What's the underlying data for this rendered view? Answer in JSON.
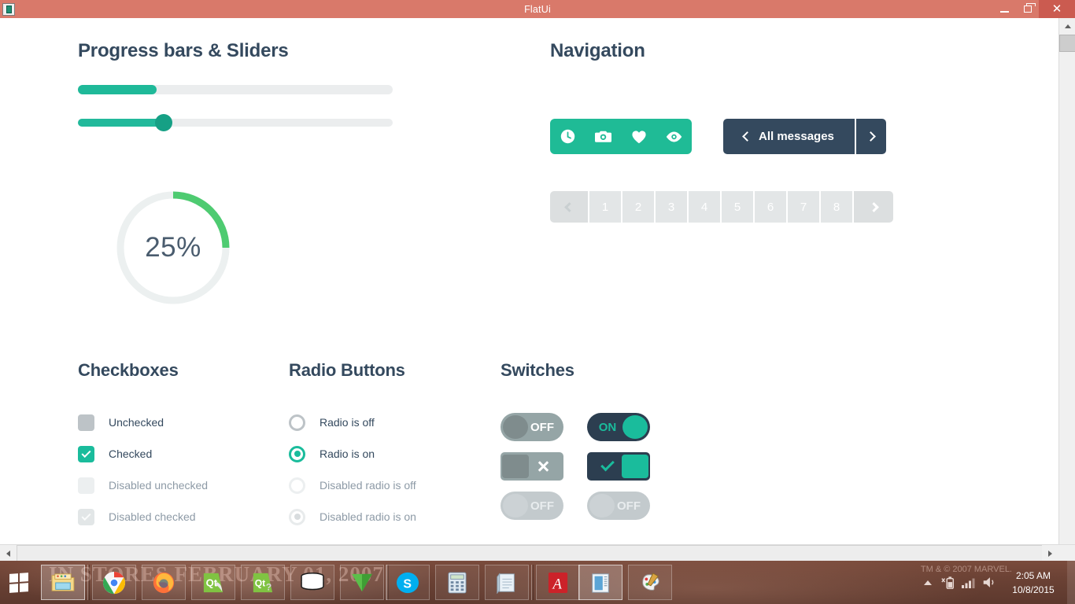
{
  "window": {
    "title": "FlatUi",
    "app_icon": "qt-app-icon",
    "controls": {
      "minimize": "minimize",
      "maximize": "restore",
      "close": "close"
    }
  },
  "sections": {
    "progress": {
      "heading": "Progress bars & Sliders",
      "progress_bar": {
        "value": 25,
        "max": 100
      },
      "slider": {
        "value": 27,
        "max": 100
      },
      "circle": {
        "value": 25,
        "label": "25%"
      }
    },
    "navigation": {
      "heading": "Navigation",
      "icon_buttons": [
        {
          "name": "clock-icon",
          "glyph": "clock"
        },
        {
          "name": "camera-icon",
          "glyph": "camera"
        },
        {
          "name": "heart-icon",
          "glyph": "heart"
        },
        {
          "name": "eye-icon",
          "glyph": "eye"
        }
      ],
      "messages_button": {
        "label": "All  messages",
        "prev": "‹",
        "next": "›"
      },
      "pagination": {
        "prev": "prev",
        "pages": [
          "1",
          "2",
          "3",
          "4",
          "5",
          "6",
          "7",
          "8"
        ],
        "next": "next"
      }
    },
    "checkboxes": {
      "heading": "Checkboxes",
      "items": [
        {
          "label": "Unchecked",
          "state": "unchecked",
          "disabled": false
        },
        {
          "label": "Checked",
          "state": "checked",
          "disabled": false
        },
        {
          "label": "Disabled unchecked",
          "state": "unchecked",
          "disabled": true
        },
        {
          "label": "Disabled checked",
          "state": "checked",
          "disabled": true
        }
      ]
    },
    "radios": {
      "heading": "Radio Buttons",
      "items": [
        {
          "label": "Radio is off",
          "state": "off",
          "disabled": false
        },
        {
          "label": "Radio is on",
          "state": "on",
          "disabled": false
        },
        {
          "label": "Disabled radio is off",
          "state": "off",
          "disabled": true
        },
        {
          "label": "Disabled radio is on",
          "state": "on",
          "disabled": true
        }
      ]
    },
    "switches": {
      "heading": "Switches",
      "items": [
        {
          "name": "switch-off",
          "label": "OFF",
          "state": "off",
          "shape": "round",
          "disabled": false
        },
        {
          "name": "switch-on",
          "label": "ON",
          "state": "on",
          "shape": "round",
          "disabled": false
        },
        {
          "name": "switch-square-off",
          "label": "",
          "state": "off",
          "shape": "square",
          "icon": "x-icon",
          "disabled": false
        },
        {
          "name": "switch-square-on",
          "label": "",
          "state": "on",
          "shape": "square",
          "icon": "check-icon",
          "disabled": false
        },
        {
          "name": "switch-disabled-off-a",
          "label": "OFF",
          "state": "off",
          "shape": "round",
          "disabled": true
        },
        {
          "name": "switch-disabled-off-b",
          "label": "OFF",
          "state": "off",
          "shape": "round",
          "disabled": true
        }
      ]
    }
  },
  "colors": {
    "titlebar": "#d9796a",
    "close_button": "#cb5b50",
    "accent_green": "#1abc9c",
    "progress_green": "#1fb999",
    "circle_green": "#4ecb71",
    "dark_navy": "#34495e",
    "heading_text": "#34495e",
    "track_gray": "#ebedee",
    "pagination_gray": "#e3e6e7",
    "switch_gray": "#95a5a6",
    "taskbar": "#6f4436"
  },
  "taskbar": {
    "start": "start-button",
    "background_text": "IN STORES FEBRUARY 01, 2007",
    "trademark_text": "TM & © 2007 MARVEL.",
    "items": [
      {
        "name": "taskbar-file-explorer",
        "icon": "folder-icon",
        "active": true
      },
      {
        "name": "taskbar-google-chrome",
        "icon": "chrome-icon",
        "active": false
      },
      {
        "name": "taskbar-firefox",
        "icon": "firefox-icon",
        "active": false
      },
      {
        "name": "taskbar-qt-creator",
        "icon": "qt-creator-icon",
        "active": false
      },
      {
        "name": "taskbar-qt-assistant",
        "icon": "qt-assistant-icon",
        "active": false
      },
      {
        "name": "taskbar-database",
        "icon": "database-icon",
        "active": false
      },
      {
        "name": "taskbar-green-triangle",
        "icon": "triangle-icon",
        "active": false
      },
      {
        "name": "taskbar-skype",
        "icon": "skype-icon",
        "active": false
      },
      {
        "name": "taskbar-calculator",
        "icon": "calculator-icon",
        "active": false
      },
      {
        "name": "taskbar-notepad",
        "icon": "notepad-icon",
        "active": false
      },
      {
        "name": "taskbar-adobe-reader",
        "icon": "adobe-reader-icon",
        "active": false
      },
      {
        "name": "taskbar-document-viewer",
        "icon": "document-icon",
        "active": true
      },
      {
        "name": "taskbar-paint",
        "icon": "paint-palette-icon",
        "active": false
      }
    ],
    "tray": {
      "show_hidden": "show-hidden-icons",
      "battery": "battery-icon",
      "network": "network-signal-icon",
      "volume": "speaker-icon"
    },
    "clock": {
      "time": "2:05 AM",
      "date": "10/8/2015"
    }
  }
}
